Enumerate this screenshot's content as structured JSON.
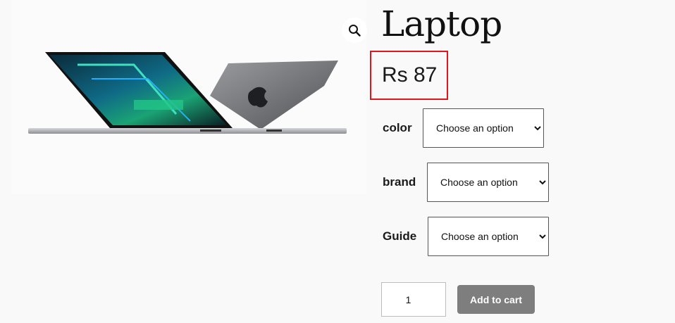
{
  "product": {
    "title": "Laptop",
    "price": "Rs 87"
  },
  "gallery": {
    "zoom_icon": "magnifier-icon",
    "image": "laptop-product-image"
  },
  "variations": [
    {
      "label": "color",
      "selected": "Choose an option"
    },
    {
      "label": "brand",
      "selected": "Choose an option"
    },
    {
      "label": "Guide",
      "selected": "Choose an option"
    }
  ],
  "cart": {
    "quantity": "1",
    "button_label": "Add to cart"
  },
  "colors": {
    "highlight_border": "#e0161b",
    "button_bg": "#7e7e7e"
  }
}
